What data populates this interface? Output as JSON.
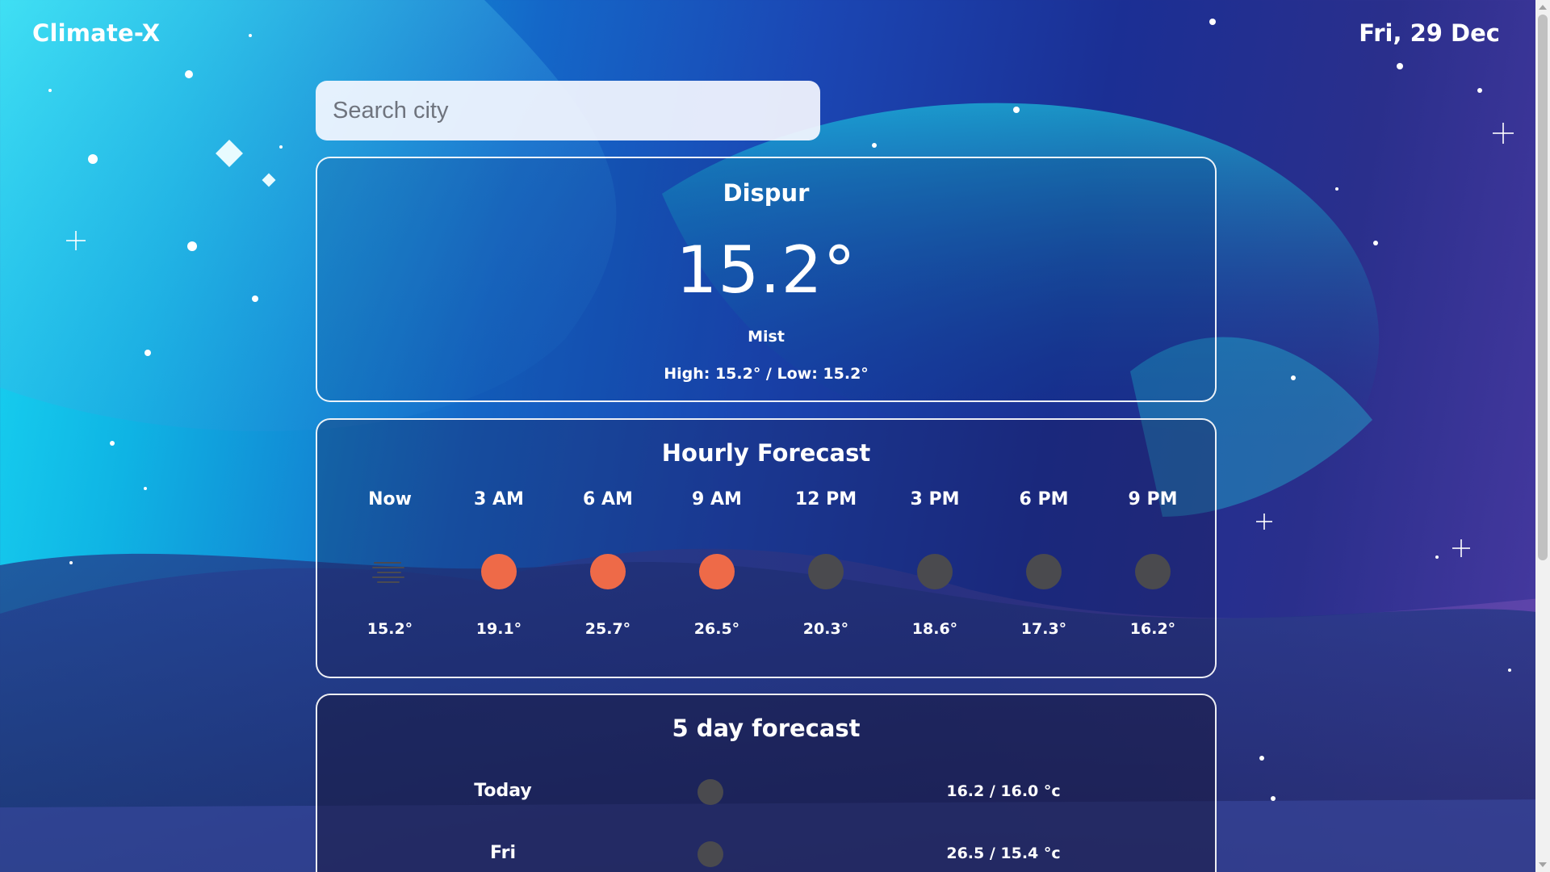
{
  "app": {
    "brand": "Climate-X",
    "date": "Fri, 29 Dec"
  },
  "search": {
    "placeholder": "Search city",
    "value": ""
  },
  "current": {
    "city": "Dispur",
    "temp": "15.2°",
    "condition": "Mist",
    "high_low": "High: 15.2° / Low: 15.2°"
  },
  "hourly": {
    "title": "Hourly Forecast",
    "items": [
      {
        "time": "Now",
        "icon": "mist-icon",
        "temp": "15.2°"
      },
      {
        "time": "3 AM",
        "icon": "sun-icon",
        "temp": "19.1°"
      },
      {
        "time": "6 AM",
        "icon": "sun-icon",
        "temp": "25.7°"
      },
      {
        "time": "9 AM",
        "icon": "sun-icon",
        "temp": "26.5°"
      },
      {
        "time": "12 PM",
        "icon": "moon-icon",
        "temp": "20.3°"
      },
      {
        "time": "3 PM",
        "icon": "moon-icon",
        "temp": "18.6°"
      },
      {
        "time": "6 PM",
        "icon": "moon-icon",
        "temp": "17.3°"
      },
      {
        "time": "9 PM",
        "icon": "moon-icon",
        "temp": "16.2°"
      }
    ]
  },
  "daily": {
    "title": "5 day forecast",
    "items": [
      {
        "day": "Today",
        "icon": "moon-icon",
        "range": "16.2 / 16.0 °c"
      },
      {
        "day": "Fri",
        "icon": "moon-icon",
        "range": "26.5 / 15.4 °c"
      }
    ]
  },
  "colors": {
    "sun": "#ee6a48",
    "moon": "#4a4a4e",
    "card_border": "#ffffff",
    "search_bg": "#f5f7ff"
  }
}
